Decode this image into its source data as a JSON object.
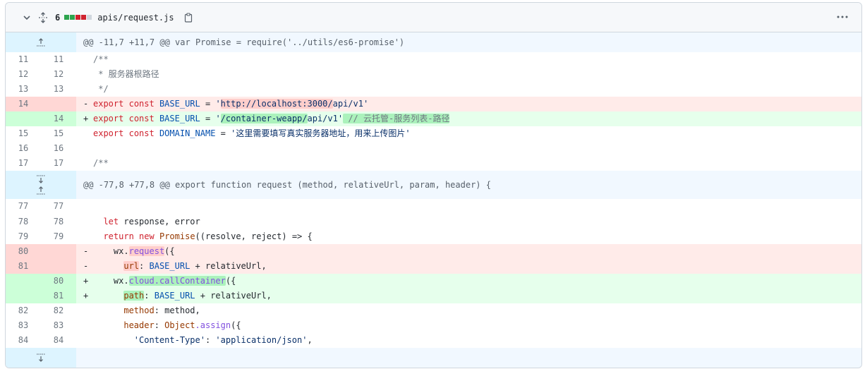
{
  "file": {
    "line_count": "6",
    "name": "apis/request.js",
    "diffstat": [
      "#2da44e",
      "#2da44e",
      "#cf222e",
      "#cf222e",
      "#d0d7de"
    ]
  },
  "hunks": {
    "first": "@@ -11,7 +11,7 @@ var Promise = require('../utils/es6-promise')",
    "second": "@@ -77,8 +77,8 @@ export function request (method, relativeUrl, param, header) {"
  },
  "lines": [
    {
      "old": "11",
      "new": "11"
    },
    {
      "old": "12",
      "new": "12"
    },
    {
      "old": "13",
      "new": "13"
    },
    {
      "old": "14",
      "new": ""
    },
    {
      "old": "",
      "new": "14"
    },
    {
      "old": "15",
      "new": "15"
    },
    {
      "old": "16",
      "new": "16"
    },
    {
      "old": "17",
      "new": "17"
    },
    {
      "old": "77",
      "new": "77"
    },
    {
      "old": "78",
      "new": "78"
    },
    {
      "old": "79",
      "new": "79"
    },
    {
      "old": "80",
      "new": ""
    },
    {
      "old": "81",
      "new": ""
    },
    {
      "old": "",
      "new": "80"
    },
    {
      "old": "",
      "new": "81"
    },
    {
      "old": "82",
      "new": "82"
    },
    {
      "old": "83",
      "new": "83"
    },
    {
      "old": "84",
      "new": "84"
    }
  ],
  "text": {
    "c1": "/**",
    "c2": " * 服务器根路径",
    "c3": " */",
    "minus": "-",
    "plus": "+",
    "export": "export",
    "const": "const",
    "base_url": "BASE_URL",
    "eq": " = ",
    "q": "'",
    "old_host": "http://localhost:3000/",
    "api_v1": "api/v1",
    "new_prefix": "/container-weapp/",
    "new_comment": " // 云托管-服务列表-路径",
    "domain_name": "DOMAIN_NAME",
    "domain_str": "'这里需要填写真实服务器地址，用来上传图片'",
    "c4": "/**",
    "let": "let",
    "response_error": " response, error",
    "return": "return",
    "new": "new",
    "promise": "Promise",
    "promise_args": "((resolve, reject) => {",
    "wx": "wx.",
    "request": "request",
    "open": "({",
    "url": "url",
    "colon": ": ",
    "plus_op": " + ",
    "relative": "relativeUrl,",
    "cloud": "cloud.callContainer",
    "path": "path",
    "method_key": "method",
    "method_val": ": method,",
    "header_key": "header",
    "object": "Object",
    "assign": ".assign",
    "ct_key": "'Content-Type'",
    "ct_val": "'application/json'",
    "ct_sep": ": ",
    "comma": ","
  }
}
